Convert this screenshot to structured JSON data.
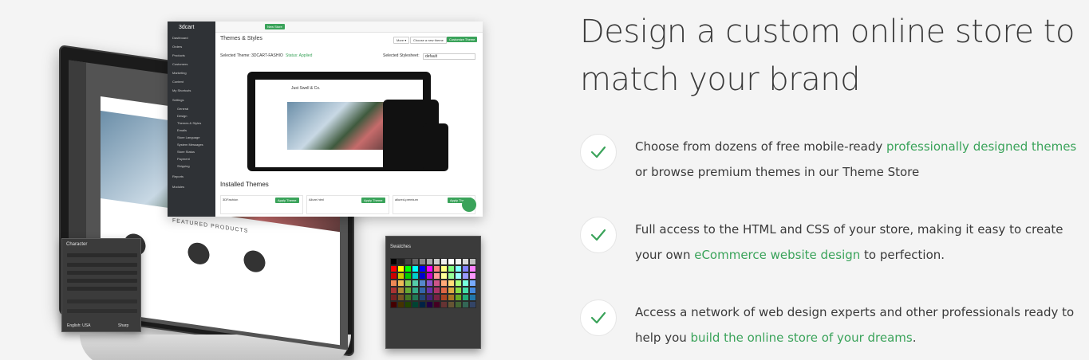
{
  "heading": "Design a custom online store to match your brand",
  "features": [
    {
      "before": "Choose from dozens of free mobile-ready ",
      "link": "professionally designed themes",
      "after": " or browse premium themes in our Theme Store"
    },
    {
      "before": "Full access to the HTML and CSS of your store, making it easy to create your own ",
      "link": "eCommerce website design",
      "after": " to perfection."
    },
    {
      "before": "Access a network of web design experts and other professionals ready to help you ",
      "link": "build the online store of your dreams",
      "after": "."
    }
  ],
  "colors": {
    "accent": "#3aa35a",
    "heading": "#3a3a3a",
    "background": "#f4f4f4"
  },
  "icons": {
    "check": "check-icon"
  },
  "illustration": {
    "admin": {
      "logo": "3dcart",
      "new_store_button": "New Store",
      "page_title": "Themes & Styles",
      "more_button": "More ▾",
      "choose_theme_button": "Choose a new theme",
      "customize_button": "Customize Theme",
      "selected_theme": "Selected Theme: 3DCART-FASHIO",
      "status": "Status: Applied",
      "stylesheet": "Selected Stylesheet:",
      "stylesheet_value": "default",
      "store_name": "Just Swell & Co.",
      "installed_label": "Installed Themes",
      "themes": [
        "3DFashion",
        "Allure.html",
        "allured-premium"
      ],
      "apply_label": "Apply Theme",
      "sidebar": [
        "Dashboard",
        "Orders",
        "Products",
        "Customers",
        "Marketing",
        "Content",
        "My Shortcuts",
        "Settings",
        "General",
        "Design",
        "Themes & Styles",
        "Emails",
        "Store Language",
        "System Messages",
        "Store Status",
        "Payment",
        "Shipping",
        "Reports",
        "Modules"
      ]
    },
    "photoshop": {
      "featured": "FEATURED PRODUCTS"
    },
    "character_panel": {
      "title": "Character",
      "footer_left": "English: USA",
      "footer_right": "Sharp"
    },
    "swatches_panel": {
      "title": "Swatches"
    }
  }
}
